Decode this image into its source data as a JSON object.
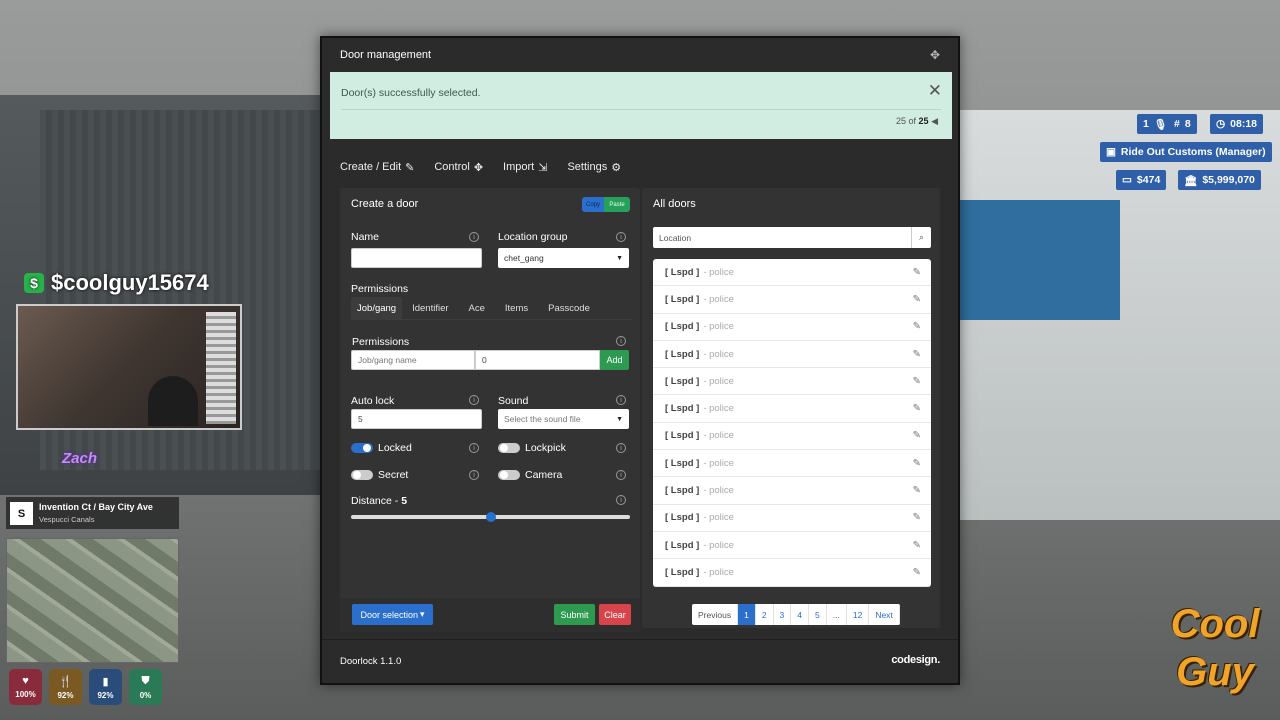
{
  "panel": {
    "title": "Door management",
    "alert": {
      "message": "Door(s) successfully selected.",
      "count_current": "25 of",
      "count_total": "25"
    },
    "tabs": [
      {
        "label": "Create / Edit",
        "icon": "edit-icon"
      },
      {
        "label": "Control",
        "icon": "move-icon"
      },
      {
        "label": "Import",
        "icon": "import-icon"
      },
      {
        "label": "Settings",
        "icon": "gear-icon"
      }
    ],
    "create": {
      "title": "Create a door",
      "copy_label": "Copy",
      "paste_label": "Paste",
      "name_label": "Name",
      "name_value": "",
      "location_group_label": "Location group",
      "location_group_value": "chet_gang",
      "permissions_heading": "Permissions",
      "perm_tabs": [
        "Job/gang",
        "Identifier",
        "Ace",
        "Items",
        "Passcode"
      ],
      "perm_label": "Permissions",
      "perm_job_placeholder": "Job/gang name",
      "perm_grade_value": "0",
      "add_label": "Add",
      "autolock_label": "Auto lock",
      "autolock_value": "5",
      "sound_label": "Sound",
      "sound_placeholder": "Select the sound file",
      "locked_label": "Locked",
      "lockpick_label": "Lockpick",
      "secret_label": "Secret",
      "camera_label": "Camera",
      "locked": true,
      "lockpick": false,
      "secret": false,
      "camera": false,
      "distance_label": "Distance - ",
      "distance_value": "5",
      "distance_fraction": 0.5,
      "door_selection_label": "Door selection",
      "submit_label": "Submit",
      "clear_label": "Clear"
    },
    "all_doors": {
      "title": "All doors",
      "search_placeholder": "Location",
      "rows": [
        {
          "tag": "[ Lspd ]",
          "group": "- police"
        },
        {
          "tag": "[ Lspd ]",
          "group": "- police"
        },
        {
          "tag": "[ Lspd ]",
          "group": "- police"
        },
        {
          "tag": "[ Lspd ]",
          "group": "- police"
        },
        {
          "tag": "[ Lspd ]",
          "group": "- police"
        },
        {
          "tag": "[ Lspd ]",
          "group": "- police"
        },
        {
          "tag": "[ Lspd ]",
          "group": "- police"
        },
        {
          "tag": "[ Lspd ]",
          "group": "- police"
        },
        {
          "tag": "[ Lspd ]",
          "group": "- police"
        },
        {
          "tag": "[ Lspd ]",
          "group": "- police"
        },
        {
          "tag": "[ Lspd ]",
          "group": "- police"
        },
        {
          "tag": "[ Lspd ]",
          "group": "- police"
        }
      ],
      "pager": [
        "Previous",
        "1",
        "2",
        "3",
        "4",
        "5",
        "...",
        "12",
        "Next"
      ],
      "active_page": "1"
    },
    "footer": {
      "version": "Doorlock 1.1.0",
      "brand": "codesign."
    }
  },
  "hud": {
    "players": "1",
    "id": "8",
    "time": "08:18",
    "job": "Ride Out Customs (Manager)",
    "cash": "$474",
    "bank": "$5,999,070"
  },
  "overlay": {
    "username": "$coolguy15674",
    "street": "Invention Ct / Bay City Ave",
    "area": "Vespucci Canals",
    "compass": "S",
    "stats": [
      {
        "name": "health",
        "value": "100%",
        "icon": "heart-icon",
        "color": "#8a2b3b"
      },
      {
        "name": "hunger",
        "value": "92%",
        "icon": "fork-icon",
        "color": "#7a5a22"
      },
      {
        "name": "thirst",
        "value": "92%",
        "icon": "bottle-icon",
        "color": "#2a4c7a"
      },
      {
        "name": "armor",
        "value": "0%",
        "icon": "shield-icon",
        "color": "#2a7a55"
      }
    ]
  },
  "colors": {
    "primary": "#2a6fcc",
    "success": "#2e9a50",
    "danger": "#d9434a",
    "alert_bg": "#d1ece0"
  }
}
